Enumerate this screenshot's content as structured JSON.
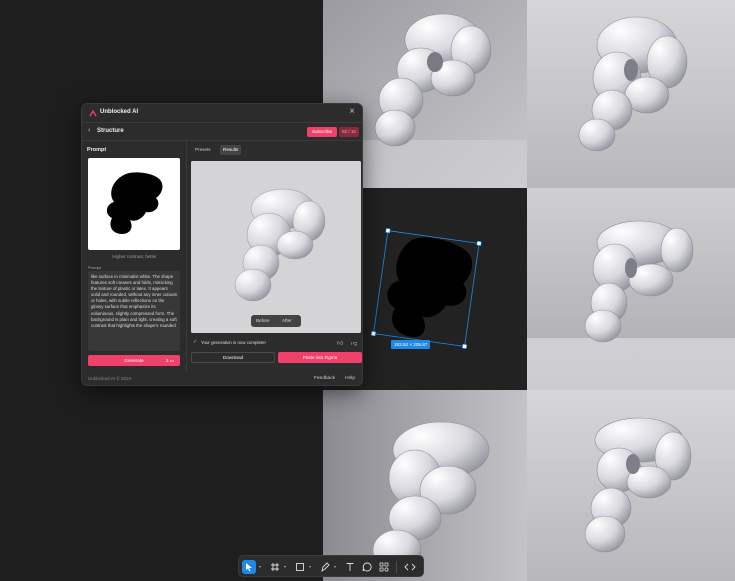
{
  "plugin": {
    "app_name": "Unblocked AI",
    "section_title": "Structure",
    "subscribe_label": "Subscribe",
    "credits_label": "82 / 10",
    "prompt_heading": "Prompt",
    "reference_hint": "Higher contrast, better",
    "prompt_label": "Prompt",
    "prompt_text": "like surface in minimalist white. The shape features soft creases and folds, mimicking the texture of plastic or latex. It appears solid and rounded, without any inner cutouts or holes, with subtle reflections on the glossy surface that emphasize its voluminous, slightly compressed form. The background is plain and light, creating a soft contrast that highlights the shape's rounded",
    "generate_label": "Generate",
    "generate_cost": "3",
    "tabs": [
      {
        "label": "Presets",
        "active": false
      },
      {
        "label": "Results",
        "active": true
      }
    ],
    "before_label": "Before",
    "after_label": "After",
    "status_text": "Your generation is now complete!",
    "download_label": "Download",
    "paste_label": "Paste into Figma",
    "copyright": "Unblocked AI © 2024",
    "feedback_label": "Feedback",
    "help_label": "Help"
  },
  "canvas": {
    "selection_size": "163.52 × 205.87"
  },
  "toolbar": {
    "tools": [
      "move-tool",
      "frame-tool",
      "shape-tool",
      "pen-tool",
      "text-tool",
      "comment-tool",
      "actions-tool",
      "dev-mode-tool"
    ],
    "active_tool": "move-tool"
  },
  "colors": {
    "accent_pink": "#f0416c",
    "selection_blue": "#1e8ae5",
    "panel_bg": "#2c2c2c",
    "canvas_bg": "#1e1e1e"
  }
}
